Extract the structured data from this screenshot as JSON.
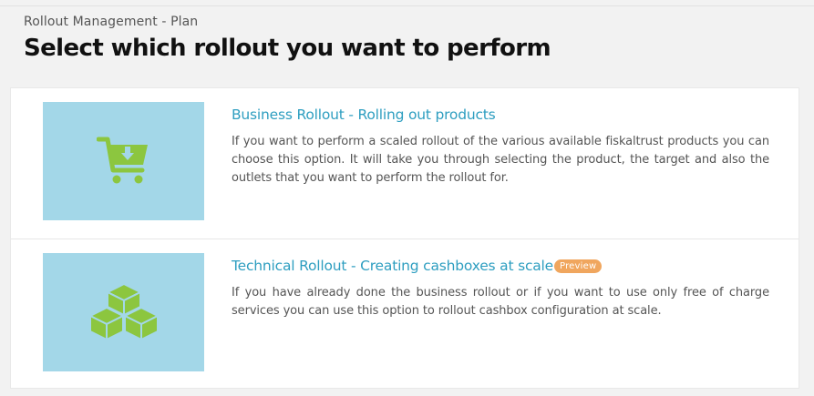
{
  "header": {
    "breadcrumb": "Rollout Management - Plan",
    "title": "Select which rollout you want to perform"
  },
  "options": [
    {
      "title": "Business Rollout - Rolling out products",
      "description": "If you want to perform a scaled rollout of the various available fiskaltrust products you can choose this option. It will take you through selecting the product, the target and also the outlets that you want to perform the rollout for.",
      "icon": "shopping-cart-icon"
    },
    {
      "title": "Technical Rollout - Creating cashboxes at scale",
      "badge": "Preview",
      "description": "If you have already done the business rollout or if you want to use only free of charge services you can use this option to rollout cashbox configuration at scale.",
      "icon": "boxes-icon"
    }
  ],
  "colors": {
    "accent": "#2e9ec0",
    "icon": "#8cc63f",
    "thumb_background": "#a3d7e8",
    "badge": "#f0a65e"
  }
}
